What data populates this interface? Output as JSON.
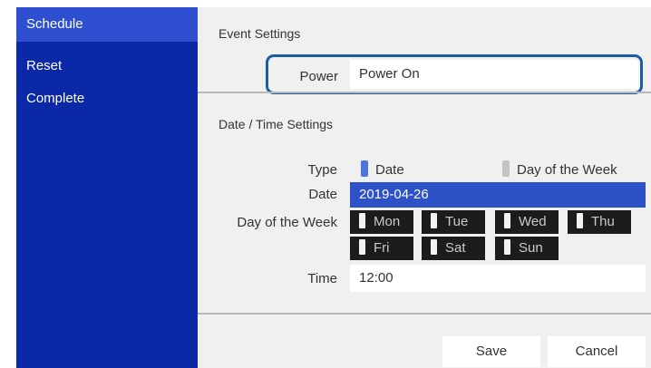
{
  "sidebar": {
    "items": [
      {
        "label": "Schedule",
        "active": true
      },
      {
        "label": "Reset",
        "active": false
      },
      {
        "label": "Complete",
        "active": false
      }
    ]
  },
  "event_settings": {
    "title": "Event Settings",
    "power_label": "Power",
    "power_value": "Power On"
  },
  "datetime_settings": {
    "title": "Date / Time Settings",
    "type_label": "Type",
    "type_options": [
      "Date",
      "Day of the Week"
    ],
    "type_selected": "Date",
    "date_label": "Date",
    "date_value": "2019-04-26",
    "dow_label": "Day of the Week",
    "days": [
      "Mon",
      "Tue",
      "Wed",
      "Thu",
      "Fri",
      "Sat",
      "Sun"
    ],
    "time_label": "Time",
    "time_value": "12:00"
  },
  "buttons": {
    "save": "Save",
    "cancel": "Cancel"
  },
  "colors": {
    "sidebar_bg": "#0b28a6",
    "sidebar_active": "#2d4fd0",
    "selection_bar": "#2d52c8",
    "highlight_border": "#1b5da3",
    "day_button_bg": "#1c1c1c"
  }
}
